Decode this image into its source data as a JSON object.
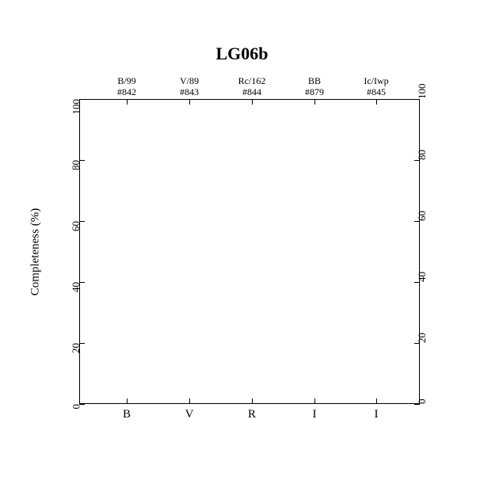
{
  "chart_data": {
    "type": "bar",
    "title": "LG06b",
    "ylabel": "Completeness (%)",
    "xlabel": "",
    "ylim": [
      0,
      100
    ],
    "yticks": [
      0,
      20,
      40,
      60,
      80,
      100
    ],
    "categories": [
      "B",
      "V",
      "R",
      "I",
      "I"
    ],
    "top_labels_line1": [
      "B/99",
      "V/89",
      "Rc/162",
      "BB",
      "Ic/Iwp"
    ],
    "top_labels_line2": [
      "#842",
      "#843",
      "#844",
      "#879",
      "#845"
    ],
    "values": []
  }
}
